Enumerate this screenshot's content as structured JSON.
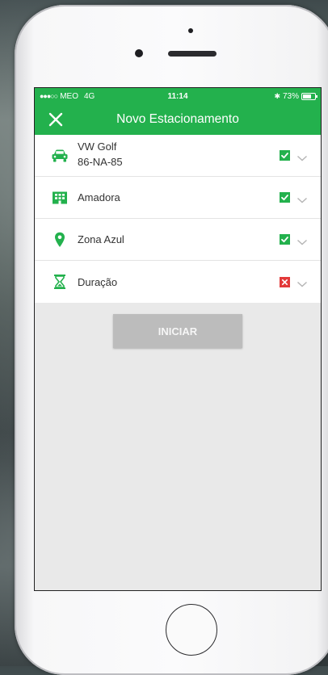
{
  "status_bar": {
    "signal": "●●●○○",
    "carrier": "MEO",
    "network": "4G",
    "time": "11:14",
    "bluetooth": "✱",
    "battery": "73%"
  },
  "header": {
    "title": "Novo Estacionamento",
    "close_icon": "close-icon"
  },
  "rows": [
    {
      "icon": "car-icon",
      "line1": "VW Golf",
      "line2": "86-NA-85",
      "status": "valid"
    },
    {
      "icon": "building-icon",
      "label": "Amadora",
      "status": "valid"
    },
    {
      "icon": "location-pin-icon",
      "label": "Zona Azul",
      "status": "valid"
    },
    {
      "icon": "hourglass-icon",
      "label": "Duração",
      "status": "invalid"
    }
  ],
  "start_button": "INICIAR",
  "colors": {
    "brand_green": "#23b14d",
    "invalid_red": "#e33a3a",
    "button_disabled": "#bcbcbc"
  }
}
